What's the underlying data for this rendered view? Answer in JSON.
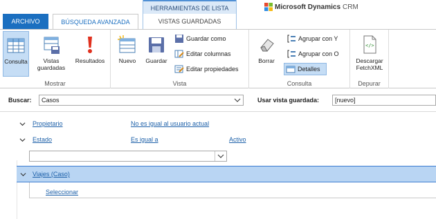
{
  "tabs": {
    "archivo": "ARCHIVO",
    "busqueda": "BÚSQUEDA AVANZADA",
    "contextual_group": "HERRAMIENTAS DE LISTA",
    "contextual_tab": "VISTAS GUARDADAS"
  },
  "brand": {
    "name_bold": "Microsoft Dynamics",
    "name_light": "CRM"
  },
  "ribbon": {
    "groups": {
      "mostrar": "Mostrar",
      "vista": "Vista",
      "consulta": "Consulta",
      "depurar": "Depurar"
    },
    "buttons": {
      "consulta": "Consulta",
      "vistas_guardadas_1": "Vistas",
      "vistas_guardadas_2": "guardadas",
      "resultados": "Resultados",
      "nuevo": "Nuevo",
      "guardar": "Guardar",
      "guardar_como": "Guardar como",
      "editar_columnas": "Editar columnas",
      "editar_propiedades": "Editar propiedades",
      "borrar": "Borrar",
      "agrupar_y": "Agrupar con Y",
      "agrupar_o": "Agrupar con O",
      "detalles": "Detalles",
      "descargar_1": "Descargar",
      "descargar_2": "FetchXML"
    }
  },
  "search": {
    "buscar_label": "Buscar:",
    "buscar_value": "Casos",
    "vista_label": "Usar vista guardada:",
    "vista_value": "[nuevo]"
  },
  "criteria": [
    {
      "field": "Propietario",
      "operator": "No es igual al usuario actual",
      "value": ""
    },
    {
      "field": "Estado",
      "operator": "Es igual a",
      "value": "Activo"
    }
  ],
  "related": {
    "entity": "Viajes (Caso)",
    "select_link": "Seleccionar"
  },
  "colors": {
    "accent": "#1b6fc0",
    "ribbon_active": "#c5ddf5",
    "entity_row": "#b9d5f3",
    "link": "#1b5fa8"
  }
}
